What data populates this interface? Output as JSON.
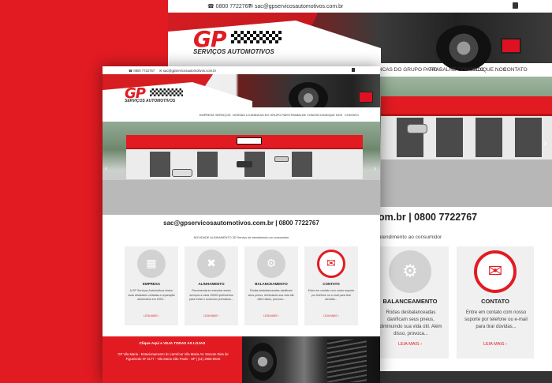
{
  "colors": {
    "brand_red": "#e21b22",
    "dark": "#222222",
    "card_bg": "#f0f0f0"
  },
  "back_view": {
    "phone": "0800 7722767",
    "email": "sac@gpservicosautomotivos.com.br",
    "logo_text": "GP",
    "logo_sub": "SERVIÇOS AUTOMOTIVOS",
    "nav": [
      "DICAS DO GRUPO PARO",
      "TRABALHE CONOSCO",
      "INDIQUE NOS",
      "CONTATO"
    ],
    "contact_line": "om.br | 0800 7722767",
    "novidade": "atendimento ao consumidor",
    "cards": [
      {
        "title": "BALANCEAMENTO",
        "text": "Rodas desbalanceadas danificam seus pneus, diminuindo sua vida útil. Além disso, provoca...",
        "more": "LEIA MAIS"
      },
      {
        "title": "CONTATO",
        "text": "Entre em contato com nosso suporte por telefone ou e-mail para tirar dúvidas...",
        "more": "LEIA MAIS"
      }
    ]
  },
  "front_view": {
    "phone": "0800 7722767",
    "email": "sac@gpservicosautomotivos.com.br",
    "logo_text": "GP",
    "logo_sub": "SERVIÇOS AUTOMOTIVOS",
    "nav": [
      "EMPRESA",
      "SERVIÇOS",
      "NOSSAS LOJAS",
      "DICAS DO GRUPO PARO",
      "TRABALHE CONOSCO",
      "INDIQUE NOS",
      "CONTATO"
    ],
    "contact_line": "sac@gpservicosautomotivos.com.br | 0800 7722767",
    "novidade": "NOVIDADE ALINHAMENTO 3D Serviço de atendimento ao consumidor",
    "cards": [
      {
        "icon": "building-icon",
        "title": "EMPRESA",
        "text": "A GP Serviços Automotivos iniciou suas atividades voltadas a reparação automotiva em 2003...",
        "more": "LEIA MAIS"
      },
      {
        "icon": "wrench-icon",
        "title": "ALINHAMENTO",
        "text": "Recomenda-se executar esses serviços a cada 10000 quilômetros para evitar o consumo prematuro...",
        "more": "LEIA MAIS"
      },
      {
        "icon": "balance-icon",
        "title": "BALANCEAMENTO",
        "text": "Rodas desbalanceadas danificam seus pneus, diminuindo sua vida útil. Além disso, provoca...",
        "more": "LEIA MAIS"
      },
      {
        "icon": "mail-icon",
        "title": "CONTATO",
        "text": "Entre em contato com nosso suporte por telefone ou e-mail para tirar dúvidas...",
        "more": "LEIA MAIS"
      }
    ],
    "footer": {
      "cta": "Clique Aqui e VEJA TODAS AS LOJAS",
      "address": "GP Vila Maria - Estacionamento do carrefour Vila Maria AV. Morvan Dias de Figueiredo Nº 3177 - Vila Maria São Paulo - SP | (11) 2955-6640"
    }
  }
}
